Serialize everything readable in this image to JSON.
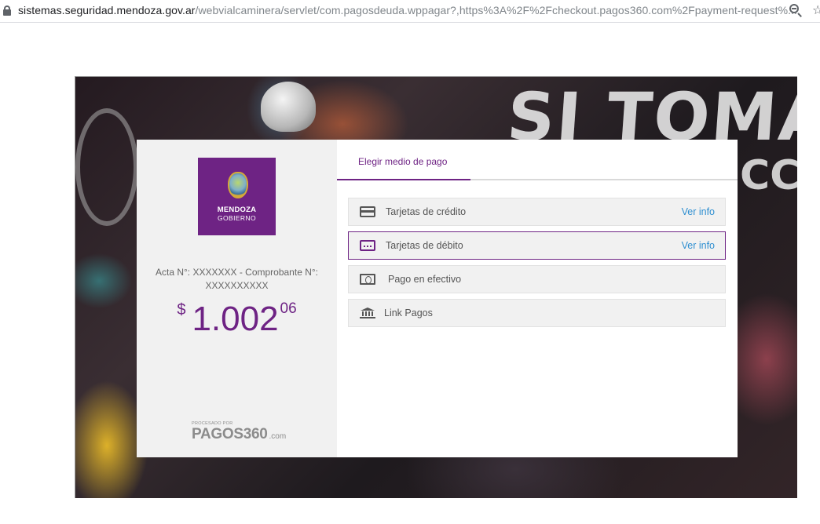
{
  "browser": {
    "url_host": "sistemas.seguridad.mendoza.gov.ar",
    "url_rest": "/webvialcaminera/servlet/com.pagosdeuda.wppagar?,https%3A%2F%2Fcheckout.pagos360.com%2Fpayment-request%..."
  },
  "banner": {
    "headline": "SI TOMA",
    "sub": "CCI"
  },
  "sidebar": {
    "logo_line1": "MENDOZA",
    "logo_line2": "GOBIERNO",
    "acta_text": "Acta N°: XXXXXXX - Comprobante N°: XXXXXXXXXX",
    "currency": "$",
    "amount_int": "1.002",
    "amount_dec": "06",
    "processed_by": "PROCESADO POR",
    "pagos_brand": "PAGOS360",
    "pagos_com": ".com"
  },
  "payment": {
    "tab_label": "Elegir medio de pago",
    "methods": [
      {
        "label": "Tarjetas de crédito",
        "info": "Ver info",
        "icon": "credit-card-icon"
      },
      {
        "label": "Tarjetas de débito",
        "info": "Ver info",
        "icon": "debit-card-icon"
      },
      {
        "label": "Pago en efectivo",
        "info": "",
        "icon": "cash-icon"
      },
      {
        "label": "Link Pagos",
        "info": "",
        "icon": "bank-icon"
      }
    ]
  },
  "colors": {
    "brand_purple": "#6e2384",
    "link_blue": "#2f8fd1",
    "panel_gray": "#f1f1f1"
  }
}
